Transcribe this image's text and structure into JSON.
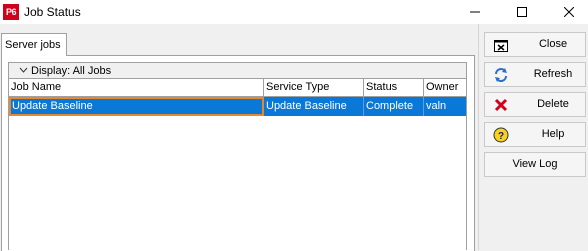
{
  "window": {
    "app_icon_text": "P6",
    "title": "Job Status"
  },
  "tabs": [
    {
      "label": "Server jobs",
      "active": true
    }
  ],
  "grid": {
    "group_label": "Display: All Jobs",
    "columns": [
      "Job Name",
      "Service Type",
      "Status",
      "Owner"
    ],
    "rows": [
      {
        "job_name": "Update Baseline",
        "service_type": "Update Baseline",
        "status": "Complete",
        "owner": "valn",
        "selected": true
      }
    ]
  },
  "toolbar": {
    "close_label": "Close",
    "refresh_label": "Refresh",
    "delete_label": "Delete",
    "help_label": "Help",
    "view_log_label": "View Log"
  },
  "icons": {
    "app": "p6-app-icon",
    "close": "close-window-icon",
    "refresh": "refresh-icon",
    "delete": "red-x-icon",
    "help": "help-question-icon"
  },
  "colors": {
    "selection": "#0a78d7",
    "focus_border": "#e6882e",
    "app_icon": "#d0021b",
    "delete_icon": "#d0021b"
  }
}
